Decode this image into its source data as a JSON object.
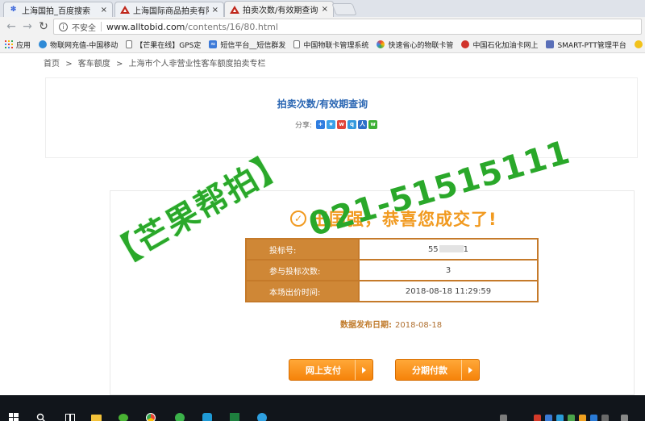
{
  "browser": {
    "tabs": [
      {
        "label": "上海国拍_百度搜索",
        "icon": "baidu-paw-icon",
        "close": "×"
      },
      {
        "label": "上海国际商品拍卖有限公",
        "icon": "warning-triangle-icon",
        "close": "×"
      },
      {
        "label": "拍卖次数/有效期查询-上",
        "icon": "warning-triangle-icon",
        "close": "×",
        "active": true
      }
    ],
    "security_label": "不安全",
    "url_host": "www.alltobid.com",
    "url_path": "/contents/16/80.html",
    "bookmarks": [
      {
        "label": "应用",
        "icon": "apps-grid-icon"
      },
      {
        "label": "物联网充值-中国移动",
        "icon": "cmcc-icon"
      },
      {
        "label": "【芒果在线】GPS定",
        "icon": "document-icon"
      },
      {
        "label": "短信平台__短信群发",
        "icon": "sms-icon"
      },
      {
        "label": "中国物联卡管理系统",
        "icon": "document-icon"
      },
      {
        "label": "快速省心的物联卡管",
        "icon": "swirl-icon"
      },
      {
        "label": "中国石化加油卡网上",
        "icon": "sinopec-icon"
      },
      {
        "label": "SMART-PTT管理平台",
        "icon": "ptt-icon"
      }
    ]
  },
  "page": {
    "breadcrumb": [
      "首页",
      ">",
      "客车额度",
      ">",
      "上海市个人非营业性客车额度拍卖专栏"
    ],
    "title": "拍卖次数/有效期查询",
    "share_label": "分享:",
    "congrats": "王国强，恭喜您成交了!",
    "rows": [
      {
        "label": "投标号:",
        "value": "55",
        "value_suffix": "1",
        "value_masked": true
      },
      {
        "label": "参与投标次数:",
        "value": "3"
      },
      {
        "label": "本场出价时间:",
        "value": "2018-08-18 11:29:59"
      }
    ],
    "publish_label": "数据发布日期:",
    "publish_date": "2018-08-18",
    "pay_online": "网上支付",
    "pay_installment": "分期付款"
  },
  "watermark": {
    "brand": "【芒果帮拍】",
    "phone": "021-51515111"
  },
  "colors": {
    "accent_orange": "#f19a20",
    "table_label_bg": "#cf8736",
    "title_blue": "#2a66b3",
    "watermark_green": "#2aa82a"
  }
}
